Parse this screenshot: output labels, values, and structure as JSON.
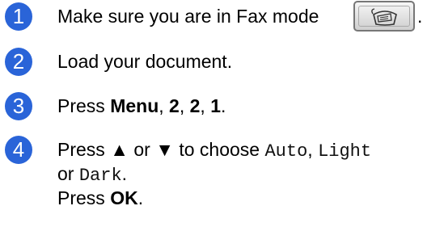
{
  "steps": [
    {
      "number": "1",
      "line1_text": "Make sure you are in Fax mode",
      "button_icon": "fax-machine-icon",
      "trailing": "."
    },
    {
      "number": "2",
      "line1_text": "Load your document."
    },
    {
      "number": "3",
      "press": "Press ",
      "menu": "Menu",
      "sep1": ", ",
      "k1": "2",
      "sep2": ", ",
      "k2": "2",
      "sep3": ", ",
      "k3": "1",
      "end": "."
    },
    {
      "number": "4",
      "press": "Press ",
      "up_arrow": "▲",
      "or1": " or ",
      "down_arrow": "▼",
      "choose": " to choose ",
      "opt_auto": "Auto",
      "comma1": ", ",
      "opt_light": "Light",
      "or2": "or ",
      "opt_dark": "Dark",
      "period": ".",
      "press_ok_pre": "Press ",
      "ok": "OK",
      "ok_end": "."
    }
  ],
  "colors": {
    "badge": "#2a64d8"
  }
}
